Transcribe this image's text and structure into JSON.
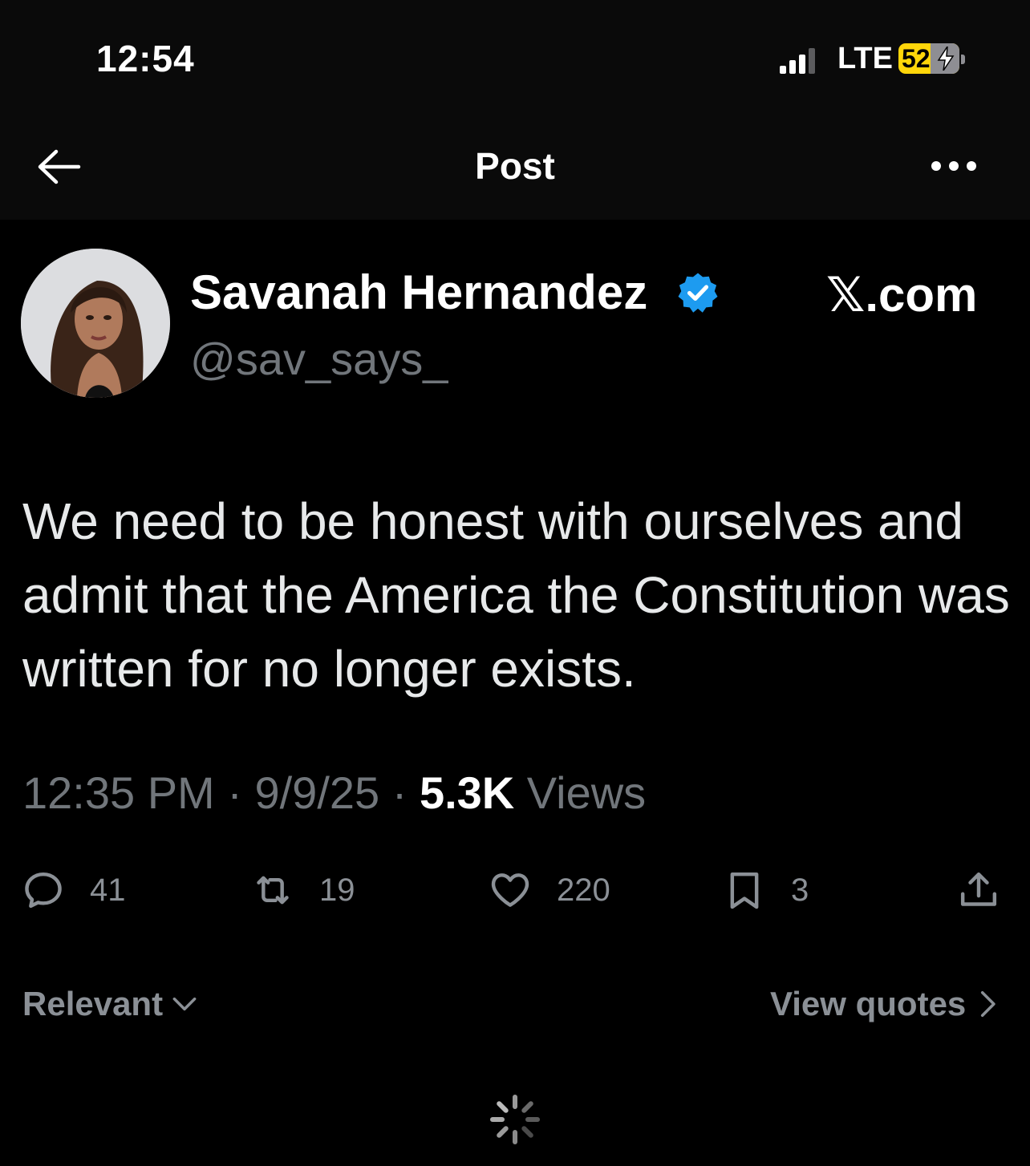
{
  "status_bar": {
    "time": "12:54",
    "network": "LTE",
    "battery_level": "52",
    "battery_percent": 52
  },
  "nav": {
    "title": "Post"
  },
  "post": {
    "author_name": "Savanah Hernandez",
    "author_handle": "@sav_says_",
    "watermark": "𝕏.com",
    "text": "We need to be honest with ourselves and admit that the America the Constitution was written for no longer exists.",
    "time": "12:35 PM",
    "date": "9/9/25",
    "views_count": "5.3K",
    "views_label": "Views",
    "replies": "41",
    "reposts": "19",
    "likes": "220",
    "bookmarks": "3"
  },
  "filters": {
    "sort_label": "Relevant",
    "view_quotes_label": "View quotes"
  },
  "colors": {
    "background": "#000000",
    "text": "#e7e9ea",
    "muted": "#71767b",
    "verified": "#1d9bf0",
    "battery": "#ffd60a"
  },
  "icons": [
    "back-arrow-icon",
    "more-icon",
    "verified-badge-icon",
    "reply-icon",
    "retweet-icon",
    "like-icon",
    "bookmark-icon",
    "share-icon",
    "chevron-down-icon",
    "chevron-right-icon",
    "loading-spinner-icon",
    "signal-icon",
    "battery-icon"
  ]
}
